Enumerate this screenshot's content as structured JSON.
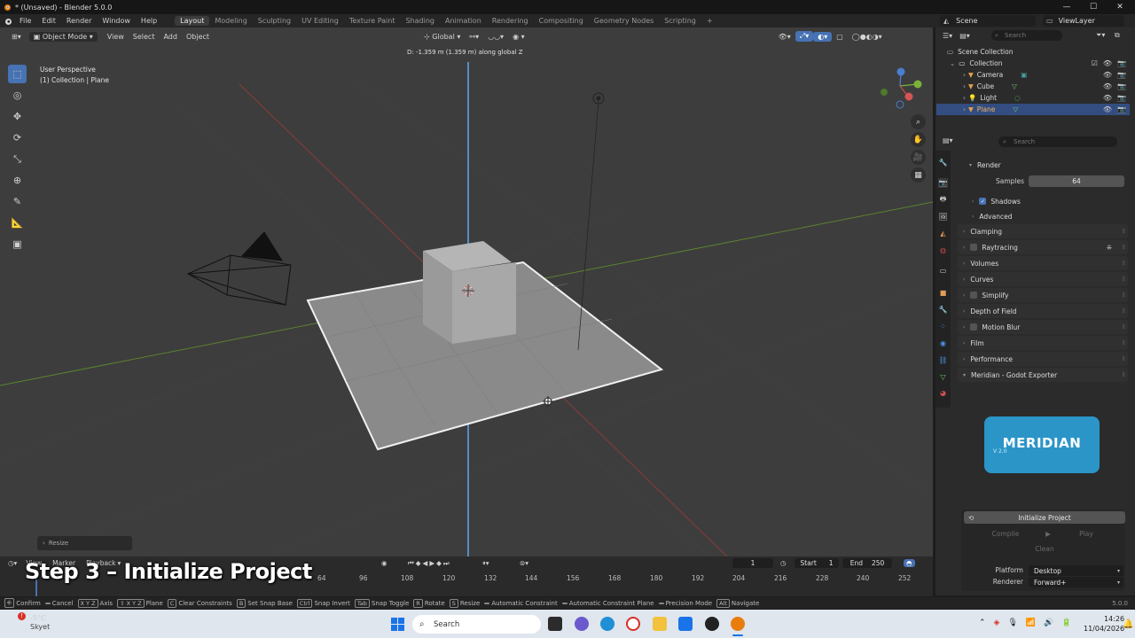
{
  "window": {
    "title": "* (Unsaved) - Blender 5.0.0"
  },
  "menu": [
    "File",
    "Edit",
    "Render",
    "Window",
    "Help"
  ],
  "workspaces": [
    "Layout",
    "Modeling",
    "Sculpting",
    "UV Editing",
    "Texture Paint",
    "Shading",
    "Animation",
    "Rendering",
    "Compositing",
    "Geometry Nodes",
    "Scripting"
  ],
  "active_workspace": "Layout",
  "scene": "Scene",
  "view_layer": "ViewLayer",
  "viewport": {
    "mode": "Object Mode",
    "menus": [
      "View",
      "Select",
      "Add",
      "Object"
    ],
    "orientation": "Global",
    "perspective": "User Perspective",
    "context": "(1) Collection | Plane",
    "operator_hint": "D: -1.359 m (1.359 m) along global Z",
    "last_operator": "Resize"
  },
  "outliner": {
    "search_placeholder": "Search",
    "root": "Scene Collection",
    "collection": "Collection",
    "objects": [
      "Camera",
      "Cube",
      "Light",
      "Plane"
    ],
    "selected": "Plane"
  },
  "properties": {
    "search_placeholder": "Search",
    "render_panel": "Render",
    "samples_label": "Samples",
    "samples_value": "64",
    "shadows": "Shadows",
    "advanced": "Advanced",
    "sections": [
      "Clamping",
      "Raytracing",
      "Volumes",
      "Curves",
      "Simplify",
      "Depth of Field",
      "Motion Blur",
      "Film",
      "Performance",
      "Meridian - Godot Exporter"
    ],
    "addon": {
      "logo_text": "MERIDIAN",
      "logo_version": "V 2.0",
      "init_button": "Initialize Project",
      "compile_button": "Compile",
      "play_button": "Play",
      "clean_button": "Clean",
      "platform_label": "Platform",
      "platform_value": "Desktop",
      "renderer_label": "Renderer",
      "renderer_value": "Forward+"
    }
  },
  "timeline": {
    "menus": [
      "View",
      "Marker",
      "Playback"
    ],
    "current_frame": "1",
    "start_label": "Start",
    "start": "1",
    "end_label": "End",
    "end": "250",
    "ticks": [
      "64",
      "96",
      "108",
      "120",
      "132",
      "144",
      "156",
      "168",
      "180",
      "192",
      "204",
      "216",
      "228",
      "240",
      "252"
    ]
  },
  "overlay_caption": "Step 3 – Initialize Project",
  "statusbar": [
    {
      "key": "⎆",
      "label": "Confirm"
    },
    {
      "key": "",
      "label": "Cancel"
    },
    {
      "key": "X Y Z",
      "label": "Axis"
    },
    {
      "key": "⇧ X Y Z",
      "label": "Plane"
    },
    {
      "key": "C",
      "label": "Clear Constraints"
    },
    {
      "key": "B",
      "label": "Set Snap Base"
    },
    {
      "key": "Ctrl",
      "label": "Snap Invert"
    },
    {
      "key": "Tab",
      "label": "Snap Toggle"
    },
    {
      "key": "R",
      "label": "Rotate"
    },
    {
      "key": "S",
      "label": "Resize"
    },
    {
      "key": "",
      "label": "Automatic Constraint"
    },
    {
      "key": "",
      "label": "Automatic Constraint Plane"
    },
    {
      "key": "",
      "label": "Precision Mode"
    },
    {
      "key": "Alt",
      "label": "Navigate"
    }
  ],
  "version": "5.0.0",
  "taskbar": {
    "weather_temp": "-5°C",
    "weather_text": "Skyet",
    "search": "Search",
    "time": "14:26",
    "date": "11/04/2026"
  },
  "colors": {
    "accent": "#4772b3",
    "selection": "#334d80",
    "x_axis": "#c84848",
    "y_axis": "#7ab23a",
    "z_axis": "#5aa3e8",
    "logo_bg": "#2b95c8"
  }
}
